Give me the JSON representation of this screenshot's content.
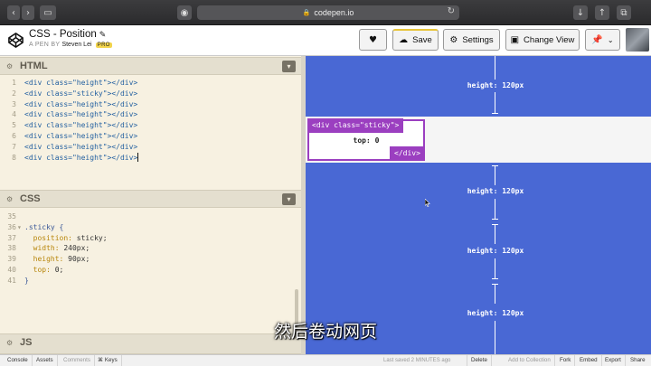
{
  "browser": {
    "url": "codepen.io",
    "icons": [
      "back-icon",
      "forward-icon",
      "sidebar-icon",
      "shield-icon",
      "lock-icon",
      "reload-icon",
      "download-icon",
      "share-icon",
      "tabs-icon"
    ]
  },
  "header": {
    "title": "CSS - Position",
    "byline": "A PEN BY",
    "author": "Steven Lei",
    "badge": "PRO",
    "buttons": {
      "save": "Save",
      "settings": "Settings",
      "change_view": "Change View"
    }
  },
  "html_panel": {
    "title": "HTML",
    "lines": [
      {
        "num": "1",
        "text": "<div class=\"height\"></div>"
      },
      {
        "num": "2",
        "text": "<div class=\"sticky\"></div>"
      },
      {
        "num": "3",
        "text": "<div class=\"height\"></div>"
      },
      {
        "num": "4",
        "text": "<div class=\"height\"></div>"
      },
      {
        "num": "5",
        "text": "<div class=\"height\"></div>"
      },
      {
        "num": "6",
        "text": "<div class=\"height\"></div>"
      },
      {
        "num": "7",
        "text": "<div class=\"height\"></div>"
      },
      {
        "num": "8",
        "text": "<div class=\"height\"></div>"
      }
    ]
  },
  "css_panel": {
    "title": "CSS",
    "lines": [
      {
        "num": "35",
        "sel": "",
        "prop": "",
        "val": "",
        "end": ""
      },
      {
        "num": "36",
        "sel": ".sticky {",
        "prop": "",
        "val": "",
        "end": ""
      },
      {
        "num": "37",
        "sel": "",
        "prop": "  position:",
        "val": " sticky;",
        "end": ""
      },
      {
        "num": "38",
        "sel": "",
        "prop": "  width:",
        "val": " 240px;",
        "end": ""
      },
      {
        "num": "39",
        "sel": "",
        "prop": "  height:",
        "val": " 90px;",
        "end": ""
      },
      {
        "num": "40",
        "sel": "",
        "prop": "  top:",
        "val": " 0;",
        "end": ""
      },
      {
        "num": "41",
        "sel": "}",
        "prop": "",
        "val": "",
        "end": ""
      }
    ],
    "fold_marker": "▾"
  },
  "js_panel": {
    "title": "JS"
  },
  "preview": {
    "height_label": "height: 120px",
    "sticky_open_tag": "<div class=\"sticky\">",
    "sticky_close_tag": "</div>",
    "sticky_text": "top: 0",
    "colors": {
      "background": "#4968d4",
      "sticky_border": "#9b3fc0"
    }
  },
  "subtitle": "然后卷动网页",
  "footer": {
    "left": [
      "Console",
      "Assets",
      "Comments",
      "⌘ Keys"
    ],
    "saved": "Last saved 2 MINUTES ago",
    "right": [
      "Delete",
      "Add to Collection",
      "Fork",
      "Embed",
      "Export",
      "Share"
    ]
  }
}
